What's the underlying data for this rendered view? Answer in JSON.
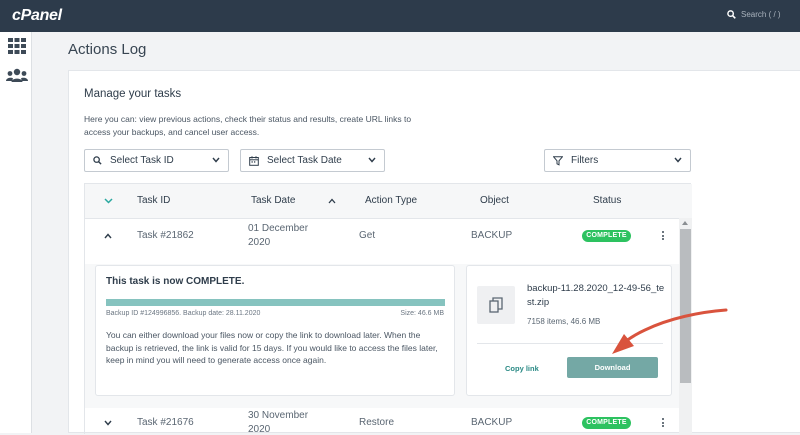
{
  "app": {
    "logo": "cPanel"
  },
  "search": {
    "placeholder": "Search ( / )"
  },
  "page": {
    "title": "Actions Log"
  },
  "panel": {
    "heading": "Manage your tasks",
    "description": "Here you can: view previous actions, check their status and results, create URL links to access your backups, and cancel user access."
  },
  "filters": {
    "task_id_label": "Select Task ID",
    "task_date_label": "Select Task Date",
    "filters_label": "Filters"
  },
  "table": {
    "columns": [
      "Task ID",
      "Task Date",
      "Action Type",
      "Object",
      "Status"
    ],
    "rows": [
      {
        "task_id": "Task #21862",
        "date_line1": "01 December",
        "date_line2": "2020",
        "action": "Get",
        "object": "BACKUP",
        "status": "COMPLETE"
      },
      {
        "task_id": "Task #21676",
        "date_line1": "30 November",
        "date_line2": "2020",
        "action": "Restore",
        "object": "BACKUP",
        "status": "COMPLETE"
      }
    ]
  },
  "details": {
    "title": "This task is now COMPLETE.",
    "progress_percent": 100,
    "backup_meta": "Backup ID #124996856. Backup date: 28.11.2020",
    "size": "Size: 46.6 MB",
    "text": "You can either download your files now or copy the link to download later. When the backup is retrieved, the link is valid for 15 days. If you would like to access the files later, keep in mind you will need to generate access once again.",
    "file_name": "backup-11.28.2020_12-49-56_test.zip",
    "file_info": "7158 items, 46.6 MB",
    "copy_link_label": "Copy link",
    "download_label": "Download"
  },
  "colors": {
    "topbar": "#2d3b4b",
    "badge_green": "#2dc260",
    "progress_fill": "#86c3bf",
    "download_button": "#74a8a5",
    "annotation_arrow": "#d9533d"
  }
}
